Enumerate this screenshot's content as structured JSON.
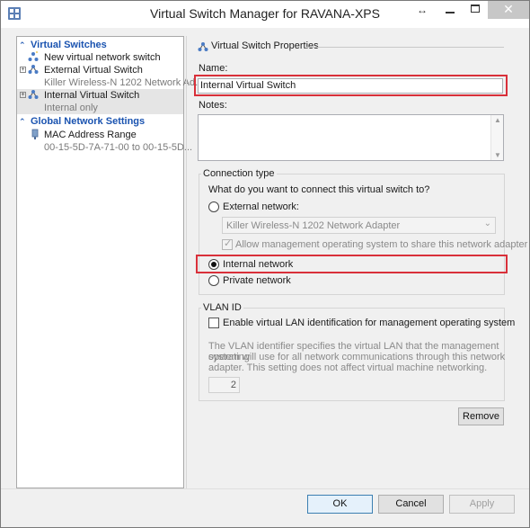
{
  "window": {
    "title": "Virtual Switch Manager for RAVANA-XPS",
    "resize_glyph": "↔",
    "close_glyph": "✕"
  },
  "tree": {
    "virtual_switches_header": "Virtual Switches",
    "new_switch": "New virtual network switch",
    "external_switch": {
      "label": "External Virtual Switch",
      "sub": "Killer Wireless-N 1202 Network Ad..."
    },
    "internal_switch": {
      "label": "Internal Virtual Switch",
      "sub": "Internal only"
    },
    "global_header": "Global Network Settings",
    "mac_range": {
      "label": "MAC Address Range",
      "sub": "00-15-5D-7A-71-00 to 00-15-5D..."
    }
  },
  "properties": {
    "section_title": "Virtual Switch Properties",
    "name_label": "Name:",
    "name_value": "Internal Virtual Switch",
    "notes_label": "Notes:",
    "notes_value": ""
  },
  "connection": {
    "title": "Connection type",
    "question": "What do you want to connect this virtual switch to?",
    "external_label": "External network:",
    "adapter": "Killer Wireless-N 1202 Network Adapter",
    "allow_mgmt": "Allow management operating system to share this network adapter",
    "internal_label": "Internal network",
    "private_label": "Private network",
    "selected": "internal"
  },
  "vlan": {
    "title": "VLAN ID",
    "enable_label": "Enable virtual LAN identification for management operating system",
    "info_line1": "The VLAN identifier specifies the virtual LAN that the management operating",
    "info_line2": "system will use for all network communications through this network",
    "info_line3": "adapter. This setting does not affect virtual machine networking.",
    "value": "2"
  },
  "buttons": {
    "remove": "Remove",
    "ok": "OK",
    "cancel": "Cancel",
    "apply": "Apply"
  },
  "colors": {
    "highlight": "#d9303a",
    "tree_header": "#1a53b0"
  }
}
